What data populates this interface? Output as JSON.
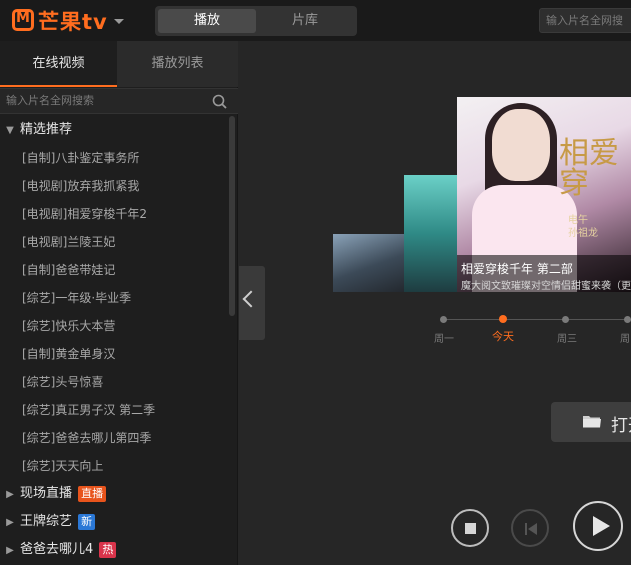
{
  "header": {
    "logo_text": "芒果tv",
    "tabs": [
      {
        "label": "播放"
      },
      {
        "label": "片库"
      }
    ],
    "search_placeholder": "输入片名全网搜"
  },
  "sidebar": {
    "tabs": [
      {
        "label": "在线视频"
      },
      {
        "label": "播放列表"
      }
    ],
    "search_placeholder": "输入片名全网搜索",
    "expanded_category": "精选推荐",
    "items": [
      "[自制]八卦鉴定事务所",
      "[电视剧]放弃我抓紧我",
      "[电视剧]相爱穿梭千年2",
      "[电视剧]兰陵王妃",
      "[自制]爸爸带娃记",
      "[综艺]一年级·毕业季",
      "[综艺]快乐大本营",
      "[自制]黄金单身汉",
      "[综艺]头号惊喜",
      "[综艺]真正男子汉 第二季",
      "[综艺]爸爸去哪儿第四季",
      "[综艺]天天向上"
    ],
    "categories": [
      {
        "label": "现场直播",
        "badge": "直播",
        "badge_color": "#e8541c"
      },
      {
        "label": "王牌综艺",
        "badge": "新",
        "badge_color": "#2b78d6"
      },
      {
        "label": "爸爸去哪儿4",
        "badge": "热",
        "badge_color": "#d9344b"
      }
    ]
  },
  "carousel": {
    "poster_title": "相爱穿",
    "poster_subtitle": "电午\n孙祖龙",
    "current_title": "相爱穿梭千年 第二部",
    "current_subtitle": "魔大阅文致璀璨对空情侣甜蜜来袭（更新至"
  },
  "days": {
    "items": [
      "周一",
      "今天",
      "周三",
      "周"
    ],
    "selected": "今天"
  },
  "open_button_label": "打开",
  "colors": {
    "accent": "#ff6d1f",
    "live_badge": "#e8541c",
    "new_badge": "#2b78d6",
    "hot_badge": "#d9344b"
  }
}
